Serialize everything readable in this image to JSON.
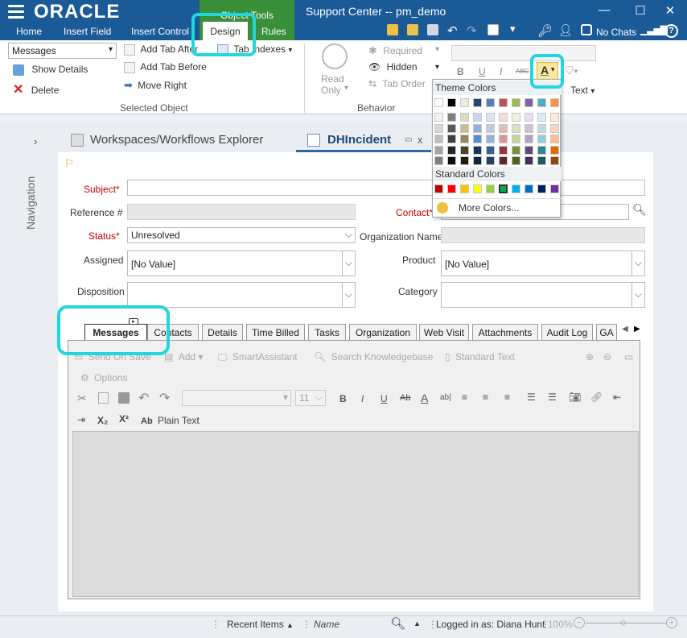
{
  "titlebar": {
    "logo": "ORACLE",
    "object_tools": "Object Tools",
    "title": "Support Center -- pm_demo",
    "minimize": "—",
    "maximize": "☐",
    "close": "✕",
    "no_chats": "No Chats"
  },
  "menu_tabs": [
    "Home",
    "Insert Field",
    "Insert Control",
    "Design",
    "Rules"
  ],
  "ribbon": {
    "selector_value": "Messages",
    "show_details": "Show Details",
    "delete": "Delete",
    "add_tab_after": "Add Tab After",
    "add_tab_before": "Add Tab Before",
    "move_right": "Move Right",
    "tab_indexes": "Tab Indexes",
    "group_selected_object": "Selected Object",
    "read_only": "Read\nOnly",
    "required": "Required",
    "hidden": "Hidden",
    "tab_order": "Tab Order",
    "group_behavior": "Behavior",
    "bold": "B",
    "underline": "U",
    "italic": "I",
    "strike": "ABC",
    "font_color_letter": "A",
    "text_label": "Text"
  },
  "color_popup": {
    "theme_title": "Theme Colors",
    "standard_title": "Standard Colors",
    "more_colors": "More Colors...",
    "theme_top": [
      "#ffffff",
      "#000000",
      "#eeece1",
      "#1f497d",
      "#4f81bd",
      "#c0504d",
      "#9bbb59",
      "#8064a2",
      "#4bacc6",
      "#f79646"
    ],
    "theme_shades": [
      [
        "#f2f2f2",
        "#7f7f7f",
        "#ddd9c3",
        "#c6d9f0",
        "#dbe5f1",
        "#f2dcdb",
        "#ebf1dd",
        "#e5e0ec",
        "#dbeef3",
        "#fdeada"
      ],
      [
        "#d8d8d8",
        "#595959",
        "#c4bd97",
        "#8db3e2",
        "#b8cce4",
        "#e5b9b7",
        "#d7e3bc",
        "#ccc1d9",
        "#b7dde8",
        "#fbd5b5"
      ],
      [
        "#bfbfbf",
        "#3f3f3f",
        "#938953",
        "#548dd4",
        "#95b3d7",
        "#d99694",
        "#c3d69b",
        "#b2a2c7",
        "#92cddc",
        "#fac08f"
      ],
      [
        "#a5a5a5",
        "#262626",
        "#494429",
        "#17365d",
        "#366092",
        "#953734",
        "#76923c",
        "#5f497a",
        "#31859b",
        "#e36c09"
      ],
      [
        "#7f7f7f",
        "#0c0c0c",
        "#1d1b10",
        "#0f243e",
        "#244061",
        "#632423",
        "#4f6128",
        "#3f3151",
        "#205867",
        "#974806"
      ]
    ],
    "standard": [
      "#c00000",
      "#ff0000",
      "#ffc000",
      "#ffff00",
      "#92d050",
      "#00b050",
      "#00b0f0",
      "#0070c0",
      "#002060",
      "#7030a0"
    ]
  },
  "nav": {
    "label": "Navigation",
    "tab_explorer": "Workspaces/Workflows Explorer",
    "tab_incident": "DHIncident",
    "tab_close": "x"
  },
  "form": {
    "subject": "Subject*",
    "reference": "Reference #",
    "contact": "Contact*",
    "status": "Status*",
    "status_value": "Unresolved",
    "org_name": "Organization Name",
    "assigned": "Assigned",
    "assigned_value": "[No Value]",
    "product": "Product",
    "product_value": "[No Value]",
    "disposition": "Disposition",
    "category": "Category"
  },
  "form_tabs": [
    "Messages",
    "Contacts",
    "Details",
    "Time Billed",
    "Tasks",
    "Organization",
    "Web Visit",
    "Attachments",
    "Audit Log",
    "GA"
  ],
  "editor_toolbar": {
    "send_on_save": "Send On Save",
    "add": "Add",
    "smart_assistant": "SmartAssistant",
    "search_kb": "Search Knowledgebase",
    "standard_text": "Standard Text",
    "options": "Options",
    "font_size": "11",
    "subscript": "X₂",
    "superscript": "X²",
    "plain_text": "Plain Text"
  },
  "statusbar": {
    "recent_items": "Recent Items",
    "name": "Name",
    "logged_in": "Logged in as: Diana Hunt",
    "zoom": "100%"
  }
}
